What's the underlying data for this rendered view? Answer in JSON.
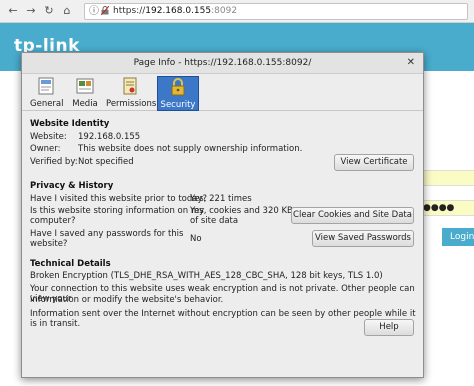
{
  "browser": {
    "url_scheme": "https://",
    "url_host": "192.168.0.155",
    "url_port": ":8092"
  },
  "background_page": {
    "logo_text": "tp-link",
    "password_mask": "●●●●",
    "login_button": "Login"
  },
  "dialog": {
    "title": "Page Info - https://192.168.0.155:8092/",
    "close_glyph": "✕",
    "tabs": [
      {
        "label": "General",
        "icon": "general-info-icon",
        "active": false
      },
      {
        "label": "Media",
        "icon": "media-icon",
        "active": false
      },
      {
        "label": "Permissions",
        "icon": "permissions-icon",
        "active": false
      },
      {
        "label": "Security",
        "icon": "lock-icon",
        "active": true
      }
    ],
    "website_identity": {
      "heading": "Website Identity",
      "website_label": "Website:",
      "website_value": "192.168.0.155",
      "owner_label": "Owner:",
      "owner_value": "This website does not supply ownership information.",
      "verified_label": "Verified by:",
      "verified_value": "Not specified",
      "view_certificate_button": "View Certificate"
    },
    "privacy_history": {
      "heading": "Privacy & History",
      "visited_question": "Have I visited this website prior to today?",
      "visited_answer": "Yes, 221 times",
      "storing_question_line1": "Is this website storing information on my",
      "storing_question_line2": "computer?",
      "storing_answer_line1": "Yes, cookies and 320 KB",
      "storing_answer_line2": "of site data",
      "clear_button": "Clear Cookies and Site Data",
      "passwords_question_line1": "Have I saved any passwords for this",
      "passwords_question_line2": "website?",
      "passwords_answer": "No",
      "view_passwords_button": "View Saved Passwords"
    },
    "technical_details": {
      "heading": "Technical Details",
      "encryption": "Broken Encryption (TLS_DHE_RSA_WITH_AES_128_CBC_SHA, 128 bit keys, TLS 1.0)",
      "weak_line1": "Your connection to this website uses weak encryption and is not private. Other people can view your",
      "weak_line2": "information or modify the website's behavior.",
      "transit_line": "Information sent over the Internet without encryption can be seen by other people while it is in transit.",
      "help_button": "Help"
    }
  }
}
